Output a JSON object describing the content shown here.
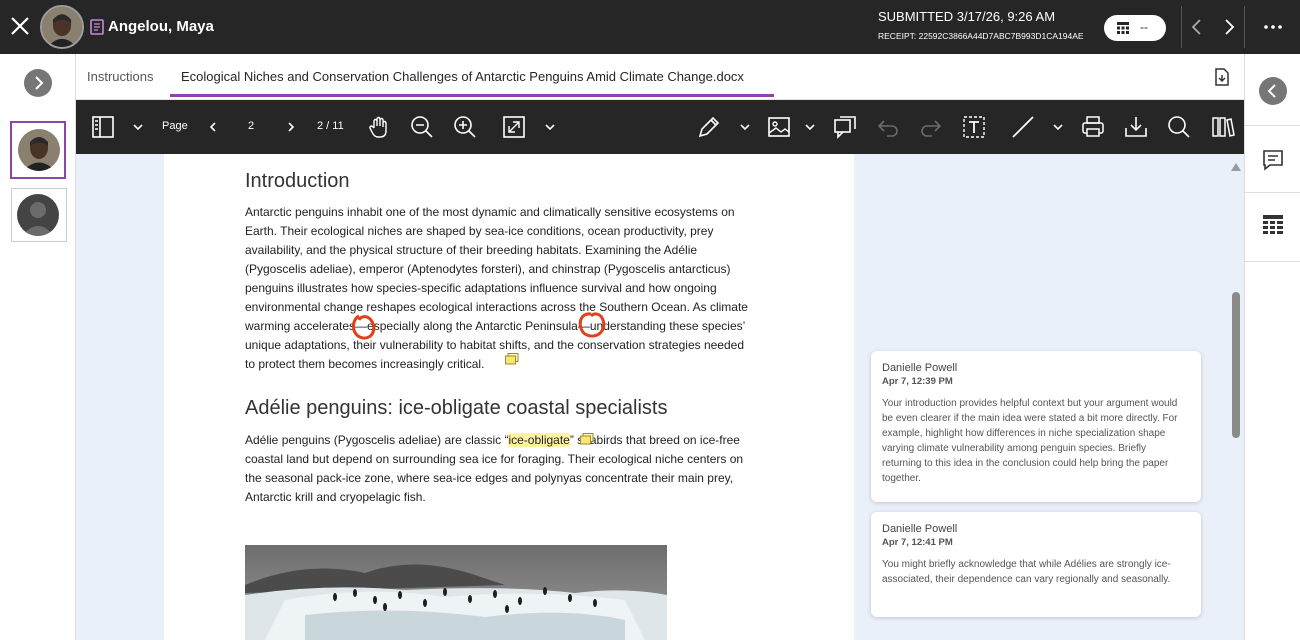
{
  "header": {
    "student_name": "Angelou, Maya",
    "submitted": "SUBMITTED 3/17/26, 9:26 AM",
    "receipt": "RECEIPT: 22592C3866A44D7ABC7B993D1CA194AE",
    "grade_value": "--"
  },
  "tabs": [
    {
      "label": "Instructions"
    },
    {
      "label": "Ecological Niches and Conservation Challenges of Antarctic Penguins Amid Climate Change.docx"
    }
  ],
  "toolbar": {
    "page_label": "Page",
    "page_number": "2",
    "page_count": "2 / 11"
  },
  "document": {
    "intro_heading": "Introduction",
    "intro_lines": [
      "Antarctic penguins inhabit one of the most dynamic and climatically sensitive ecosystems on",
      "Earth. Their ecological niches are shaped by sea-ice conditions, ocean productivity, prey",
      "availability, and the physical structure of their breeding habitats. Examining the Adélie",
      "(Pygoscelis adeliae), emperor (Aptenodytes forsteri), and chinstrap (Pygoscelis antarcticus)",
      "penguins illustrates how species-specific adaptations influence survival and how ongoing",
      "environmental change reshapes ecological interactions across the Southern Ocean. As climate",
      "warming accelerates—especially along the Antarctic Peninsula—understanding these species’",
      "unique adaptations, their vulnerability to habitat shifts, and the conservation strategies needed",
      "to protect them becomes increasingly critical."
    ],
    "adelie_heading": "Adélie penguins: ice-obligate coastal specialists",
    "adelie_line1_before": "Adélie penguins (Pygoscelis adeliae) are classic “",
    "adelie_line1_highlight": "ice-obligate",
    "adelie_line1_after": "” seabirds that breed on ice-free",
    "adelie_lines": [
      "coastal land but depend on surrounding sea ice for foraging. Their ecological niche centers on",
      "the seasonal pack-ice zone, where sea-ice edges and polynyas concentrate their main prey,",
      "Antarctic krill and cryopelagic fish."
    ]
  },
  "comments": [
    {
      "author": "Danielle Powell",
      "timestamp": "Apr 7, 12:39 PM",
      "body": "Your introduction provides helpful context but your argument would be even clearer if the main idea were stated a bit more directly. For example, highlight how differences in niche specialization shape varying climate vulnerability among penguin species. Briefly returning to this idea in the conclusion could help bring the paper together."
    },
    {
      "author": "Danielle Powell",
      "timestamp": "Apr 7, 12:41 PM",
      "body": "You might briefly acknowledge that while Adélies are strongly ice-associated, their dependence can vary regionally and seasonally."
    }
  ],
  "colors": {
    "topbar": "#262626",
    "accent_purple": "#8e44ad",
    "viewer_bg": "#eaf0fa",
    "highlight": "#fff3a3",
    "annotation_red": "#e0401a"
  }
}
